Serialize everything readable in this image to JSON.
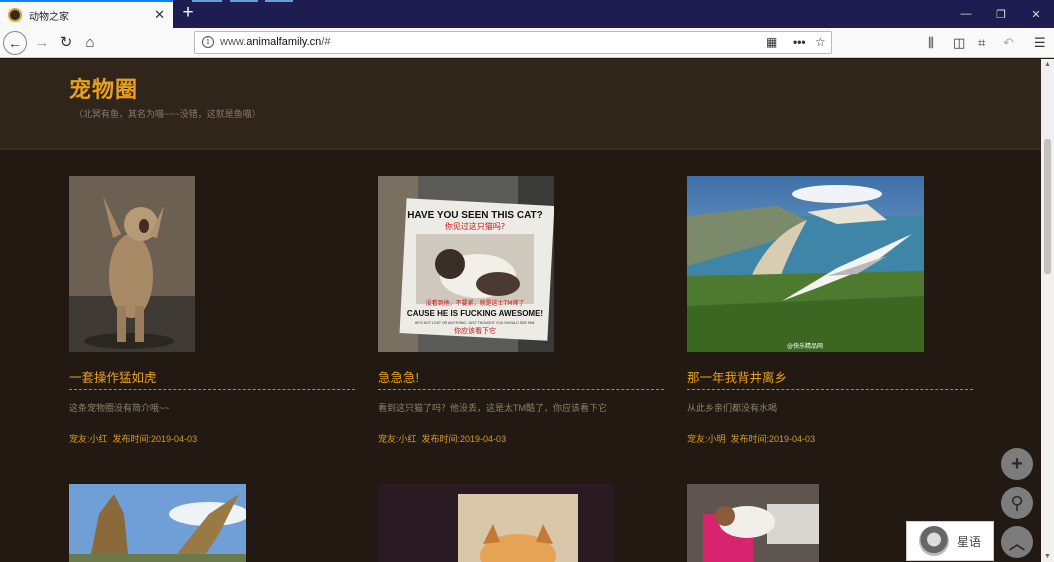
{
  "browser": {
    "tab_title": "动物之家",
    "tab_close": "✕",
    "new_tab": "+",
    "url_prefix": "www.",
    "url_domain": "animalfamily.cn",
    "url_suffix": "/#",
    "win_min": "—",
    "win_max": "❐",
    "win_close": "✕"
  },
  "header": {
    "title": "宠物圈",
    "subtitle": "（北冥有鱼，其名为喵~~~没错，这就是鱼喵）"
  },
  "posts": [
    {
      "title": "一套操作猛如虎",
      "desc": "这条宠物圈没有简介哦~~",
      "author": "宠友:小红",
      "time": "发布时间:2019-04-03"
    },
    {
      "title": "急急急!",
      "desc": "看到这只猫了吗？他没丢，这是太TM酷了，你应该看下它",
      "author": "宠友:小红",
      "time": "发布时间:2019-04-03"
    },
    {
      "title": "那一年我背井离乡",
      "desc": "从此乡亲们都没有水喝",
      "author": "宠友:小明",
      "time": "发布时间:2019-04-03"
    }
  ],
  "poster": {
    "headline": "HAVE YOU SEEN THIS CAT?",
    "headline_cn": "你见过这只猫吗?",
    "line_cn": "没看到他，不要紧，就是这士TM帅了",
    "line_en": "CAUSE HE IS FUCKING AWESOME!",
    "small": "HE'S NOT LOST OR ANYTHING, JUST THOUGHT YOU SHOULD SEE HIM.",
    "foot_cn": "你应该看下它"
  },
  "watermark": "@快乐精品网",
  "chat": {
    "label": "星语"
  },
  "float_buttons": {
    "add": "+",
    "search": "⚲",
    "top": "︿"
  }
}
